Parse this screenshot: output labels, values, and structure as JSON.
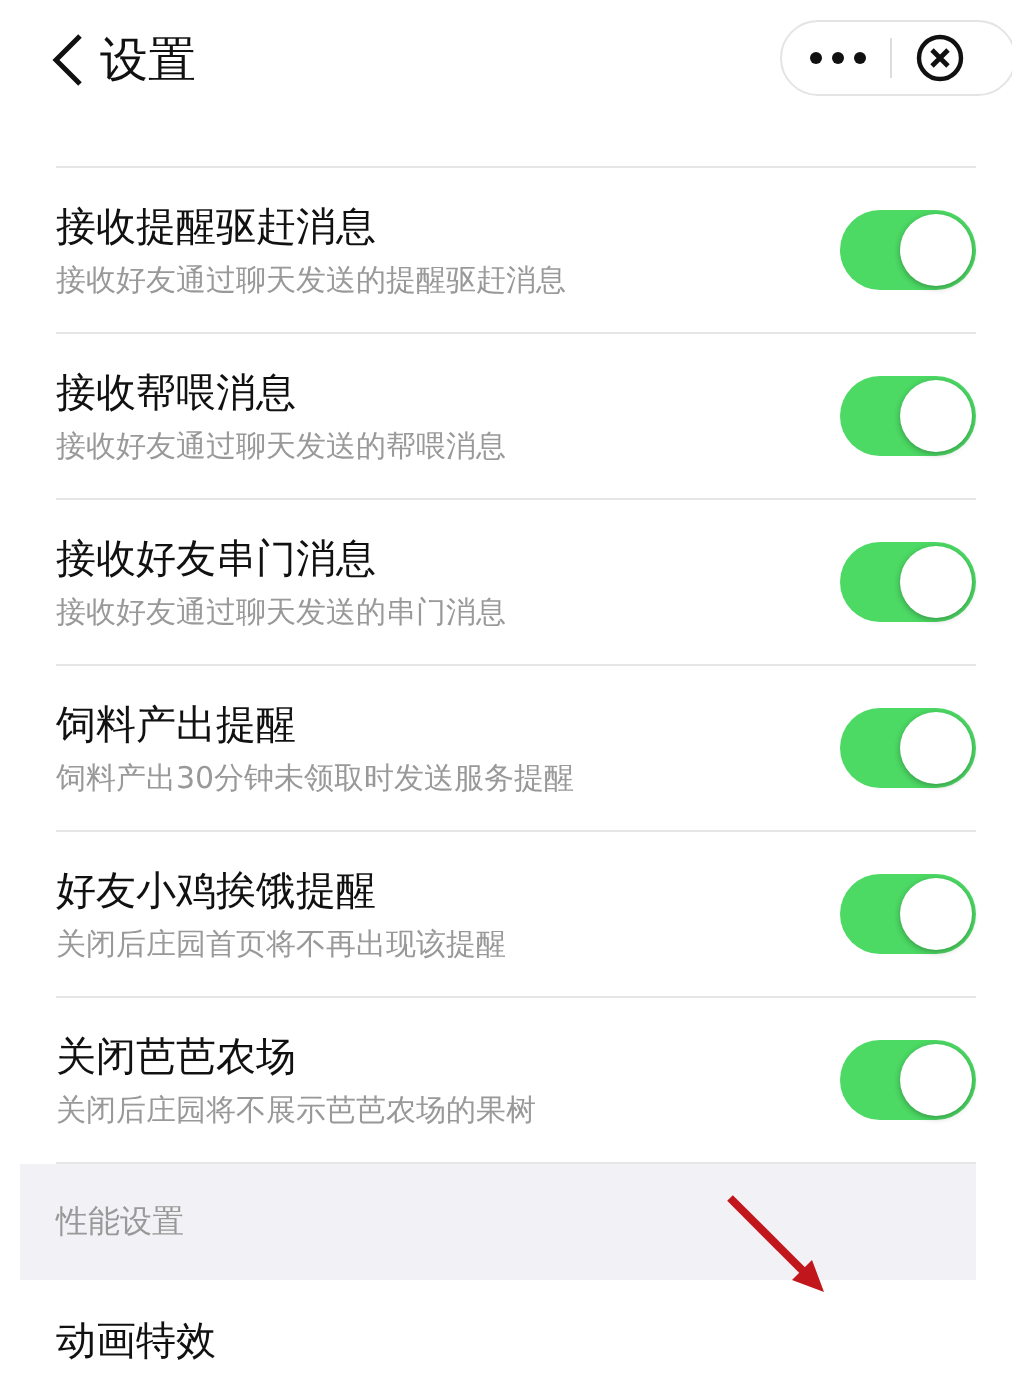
{
  "header": {
    "title": "设置"
  },
  "settings": [
    {
      "title": "接收提醒驱赶消息",
      "subtitle": "接收好友通过聊天发送的提醒驱赶消息",
      "on": true
    },
    {
      "title": "接收帮喂消息",
      "subtitle": "接收好友通过聊天发送的帮喂消息",
      "on": true
    },
    {
      "title": "接收好友串门消息",
      "subtitle": "接收好友通过聊天发送的串门消息",
      "on": true
    },
    {
      "title": "饲料产出提醒",
      "subtitle": "饲料产出30分钟未领取时发送服务提醒",
      "on": true
    },
    {
      "title": "好友小鸡挨饿提醒",
      "subtitle": "关闭后庄园首页将不再出现该提醒",
      "on": true
    },
    {
      "title": "关闭芭芭农场",
      "subtitle": "关闭后庄园将不展示芭芭农场的果树",
      "on": true
    }
  ],
  "section": {
    "title": "性能设置",
    "items": [
      {
        "title": "动画特效"
      }
    ]
  }
}
